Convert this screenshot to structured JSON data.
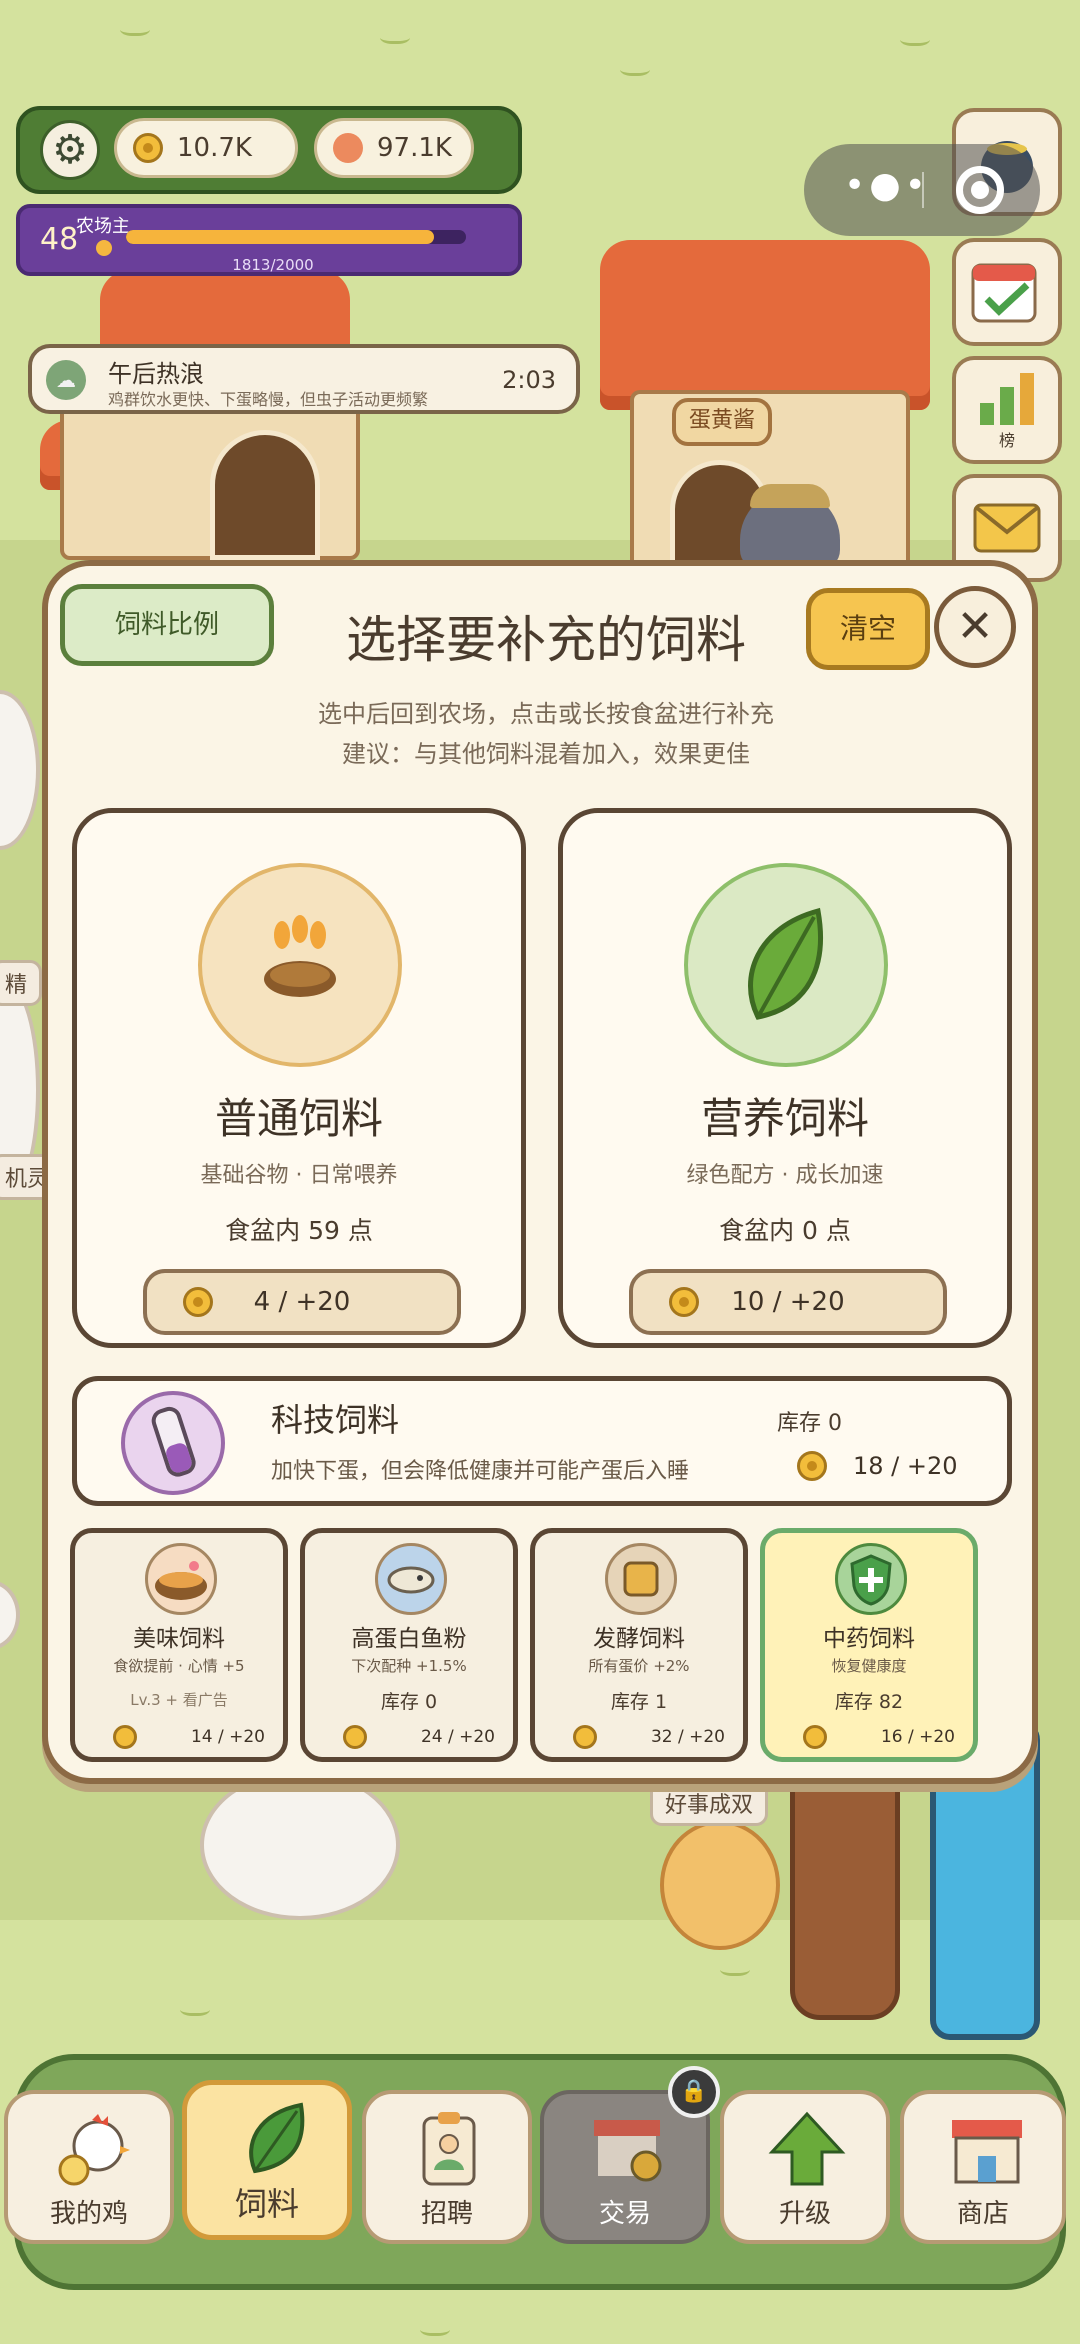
{
  "hud": {
    "coins": "10.7K",
    "gems": "97.1K",
    "level": "48",
    "level_title": "农场主",
    "exp_text": "1813/2000",
    "exp_fraction": 0.9065
  },
  "weather": {
    "title": "午后热浪",
    "desc": "鸡群饮水更快、下蛋略慢，但虫子活动更频繁",
    "time": "2:03"
  },
  "scene": {
    "house_sign": "蛋黄酱",
    "left_labels": [
      "精",
      "机灵"
    ],
    "bubble": "好事成双"
  },
  "side_buttons": {
    "rank_label": "榜"
  },
  "modal": {
    "ratio_button": "饲料比例",
    "title": "选择要补充的饲料",
    "clear_button": "清空",
    "close_button": "✕",
    "subtitle1": "选中后回到农场，点击或长按食盆进行补充",
    "subtitle2": "建议：与其他饲料混着加入，效果更佳",
    "feeds": [
      {
        "name": "普通饲料",
        "desc": "基础谷物 · 日常喂养",
        "stock": "食盆内 59 点",
        "price": "4 / +20"
      },
      {
        "name": "营养饲料",
        "desc": "绿色配方 · 成长加速",
        "stock": "食盆内 0 点",
        "price": "10 / +20"
      }
    ],
    "tech": {
      "name": "科技饲料",
      "desc": "加快下蛋，但会降低健康并可能产蛋后入睡",
      "stock": "库存 0",
      "price": "18 / +20"
    },
    "minis": [
      {
        "name": "美味饲料",
        "sub": "食欲提前 · 心情 +5",
        "lv": "Lv.3 + 看广告",
        "price": "14 / +20"
      },
      {
        "name": "高蛋白鱼粉",
        "sub": "下次配种 +1.5%",
        "stock": "库存 0",
        "price": "24 / +20"
      },
      {
        "name": "发酵饲料",
        "sub": "所有蛋价 +2%",
        "stock": "库存 1",
        "price": "32 / +20"
      },
      {
        "name": "中药饲料",
        "sub": "恢复健康度",
        "stock": "库存 82",
        "price": "16 / +20"
      }
    ]
  },
  "nav": [
    "我的鸡",
    "饲料",
    "招聘",
    "交易",
    "升级",
    "商店"
  ],
  "colors": {
    "grass": "#d4e29e",
    "hud_green": "#4f7d34",
    "level_purple": "#6a3f9a",
    "accent_yellow": "#f6c550",
    "nav_green": "#7fa75a"
  }
}
